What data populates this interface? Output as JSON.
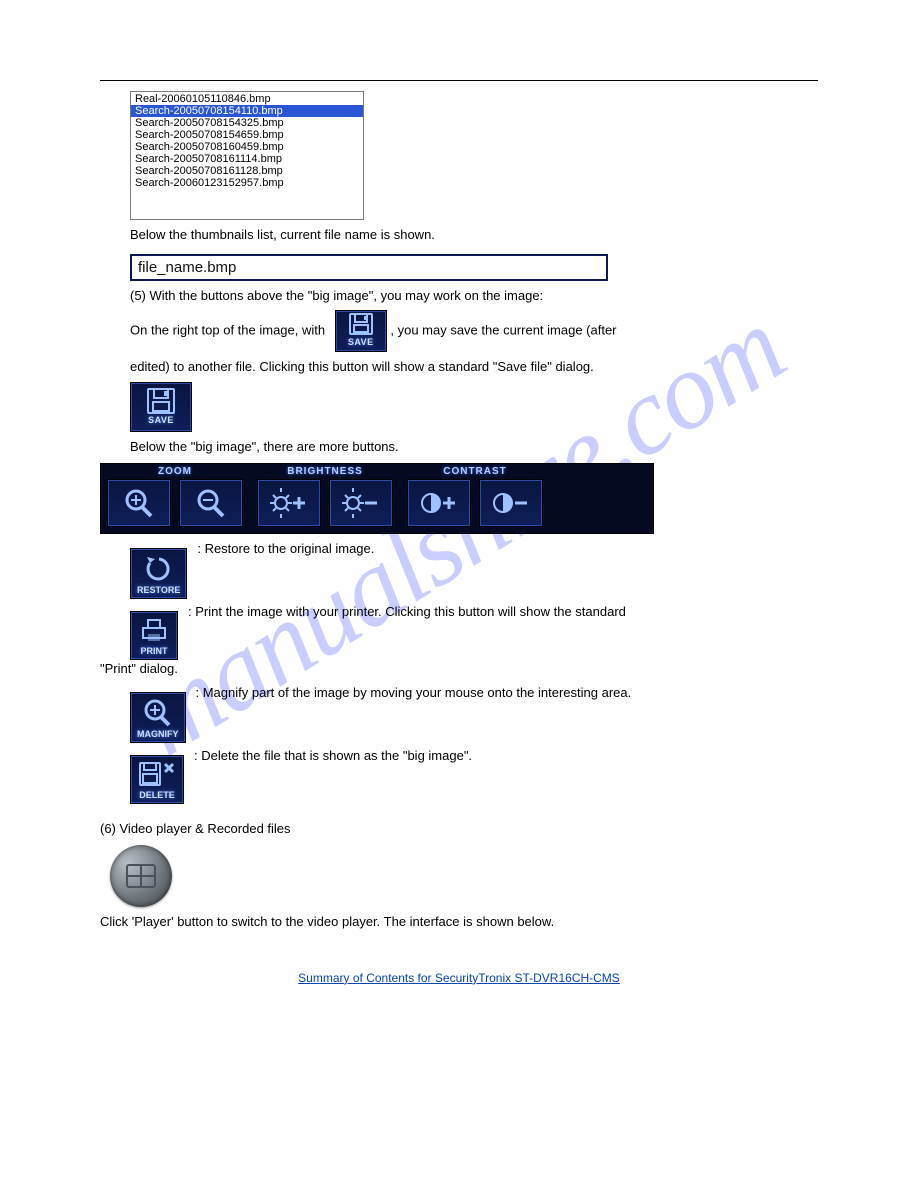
{
  "watermark": "manualshive.com",
  "filelist": {
    "items": [
      {
        "name": "Real-20060105110846.bmp",
        "selected": false
      },
      {
        "name": "Search-20050708154110.bmp",
        "selected": true
      },
      {
        "name": "Search-20050708154325.bmp",
        "selected": false
      },
      {
        "name": "Search-20050708154659.bmp",
        "selected": false
      },
      {
        "name": "Search-20050708160459.bmp",
        "selected": false
      },
      {
        "name": "Search-20050708161114.bmp",
        "selected": false
      },
      {
        "name": "Search-20050708161128.bmp",
        "selected": false
      },
      {
        "name": "Search-20060123152957.bmp",
        "selected": false
      }
    ]
  },
  "text": {
    "below_list": "Below the thumbnails list, current file name is shown.",
    "name_field_value": "file_name.bmp",
    "above_save": "(5) With the buttons above the \"big image\", you may work on the image:",
    "save_line_a": "On the right top of the image, with",
    "save_line_b": ", you may save the current image (after",
    "save_line_c": "edited) to another file. Clicking this button will show a standard \"Save file\" dialog.",
    "save_below": "Below the \"big image\", there are more buttons.",
    "restore_right": ": Restore to the original image.",
    "print_right": ": Print the image with your printer. Clicking this button will show the standard",
    "print_dialog": "\"Print\" dialog.",
    "magnify_right": ": Magnify part of the image by moving your mouse onto the interesting area.",
    "delete_right": ": Delete the file that is shown as the \"big image\".",
    "section6": "(6) Video player & Recorded files",
    "player_text": "Click 'Player' button to switch to the video player. The interface is shown below.",
    "btn_save": "SAVE",
    "btn_restore": "RESTORE",
    "btn_print": "PRINT",
    "btn_magnify": "MAGNIFY",
    "btn_delete": "DELETE",
    "grp_zoom": "ZOOM",
    "grp_brightness": "BRIGHTNESS",
    "grp_contrast": "CONTRAST"
  },
  "footer": {
    "text": "Summary of Contents for SecurityTronix ST-DVR16CH-CMS"
  }
}
